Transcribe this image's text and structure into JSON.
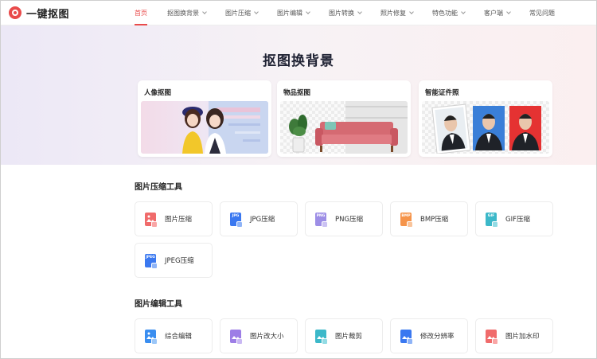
{
  "brand": {
    "name": "一键抠图",
    "color": "#e94b4b"
  },
  "nav": {
    "items": [
      {
        "label": "首页",
        "active": true,
        "has_dropdown": false
      },
      {
        "label": "抠图换背景",
        "active": false,
        "has_dropdown": true
      },
      {
        "label": "图片压缩",
        "active": false,
        "has_dropdown": true
      },
      {
        "label": "图片编辑",
        "active": false,
        "has_dropdown": true
      },
      {
        "label": "图片转换",
        "active": false,
        "has_dropdown": true
      },
      {
        "label": "照片修复",
        "active": false,
        "has_dropdown": true
      },
      {
        "label": "特色功能",
        "active": false,
        "has_dropdown": true
      },
      {
        "label": "客户端",
        "active": false,
        "has_dropdown": true
      },
      {
        "label": "常见问题",
        "active": false,
        "has_dropdown": false
      }
    ]
  },
  "hero": {
    "title": "抠图换背景",
    "cards": [
      {
        "title": "人像抠图"
      },
      {
        "title": "物品抠图"
      },
      {
        "title": "智能证件照"
      }
    ]
  },
  "compress": {
    "title": "图片压缩工具",
    "tools": [
      {
        "label": "图片压缩",
        "tag": "",
        "color": "#f06b6b"
      },
      {
        "label": "JPG压缩",
        "tag": "JPG",
        "color": "#3a78f0"
      },
      {
        "label": "PNG压缩",
        "tag": "PNG",
        "color": "#9d8ee6"
      },
      {
        "label": "BMP压缩",
        "tag": "BMP",
        "color": "#f5944a"
      },
      {
        "label": "GIF压缩",
        "tag": "GIF",
        "color": "#3cb8c9"
      },
      {
        "label": "JPEG压缩",
        "tag": "JPEG",
        "color": "#3a78f0"
      }
    ]
  },
  "edit": {
    "title": "图片编辑工具",
    "tools": [
      {
        "label": "综合编辑",
        "color": "#3a8ef0"
      },
      {
        "label": "图片改大小",
        "color": "#9d7ee6"
      },
      {
        "label": "图片裁剪",
        "color": "#3cb8c9"
      },
      {
        "label": "修改分辨率",
        "color": "#3a78f0"
      },
      {
        "label": "图片加水印",
        "color": "#f06b6b"
      }
    ]
  }
}
